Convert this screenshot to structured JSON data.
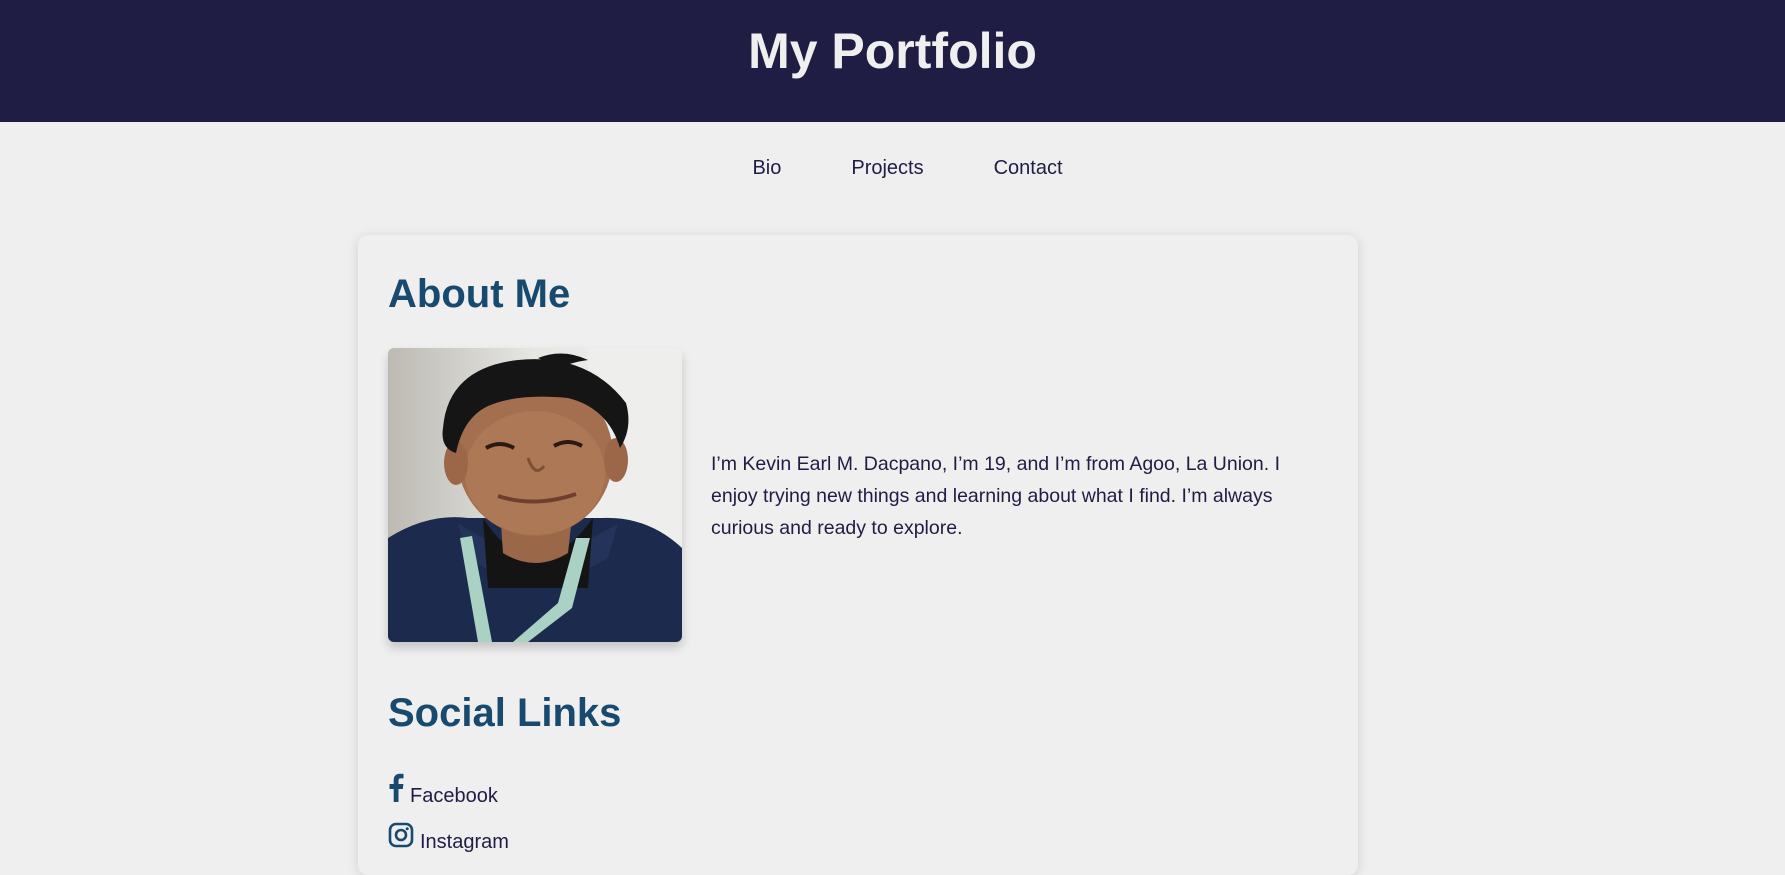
{
  "header": {
    "title": "My Portfolio"
  },
  "nav": {
    "items": [
      {
        "label": "Bio"
      },
      {
        "label": "Projects"
      },
      {
        "label": "Contact"
      }
    ]
  },
  "about": {
    "heading": "About Me",
    "bio": "I’m Kevin Earl M. Dacpano, I’m 19, and I’m from Agoo, La Union. I enjoy trying new things and learning about what I find. I’m always curious and ready to explore."
  },
  "social": {
    "heading": "Social Links",
    "links": [
      {
        "label": "Facebook",
        "icon": "facebook-icon"
      },
      {
        "label": "Instagram",
        "icon": "instagram-icon"
      }
    ]
  },
  "colors": {
    "header_bg": "#201d45",
    "page_bg": "#efefef",
    "heading": "#174a6e",
    "text": "#201d45"
  }
}
